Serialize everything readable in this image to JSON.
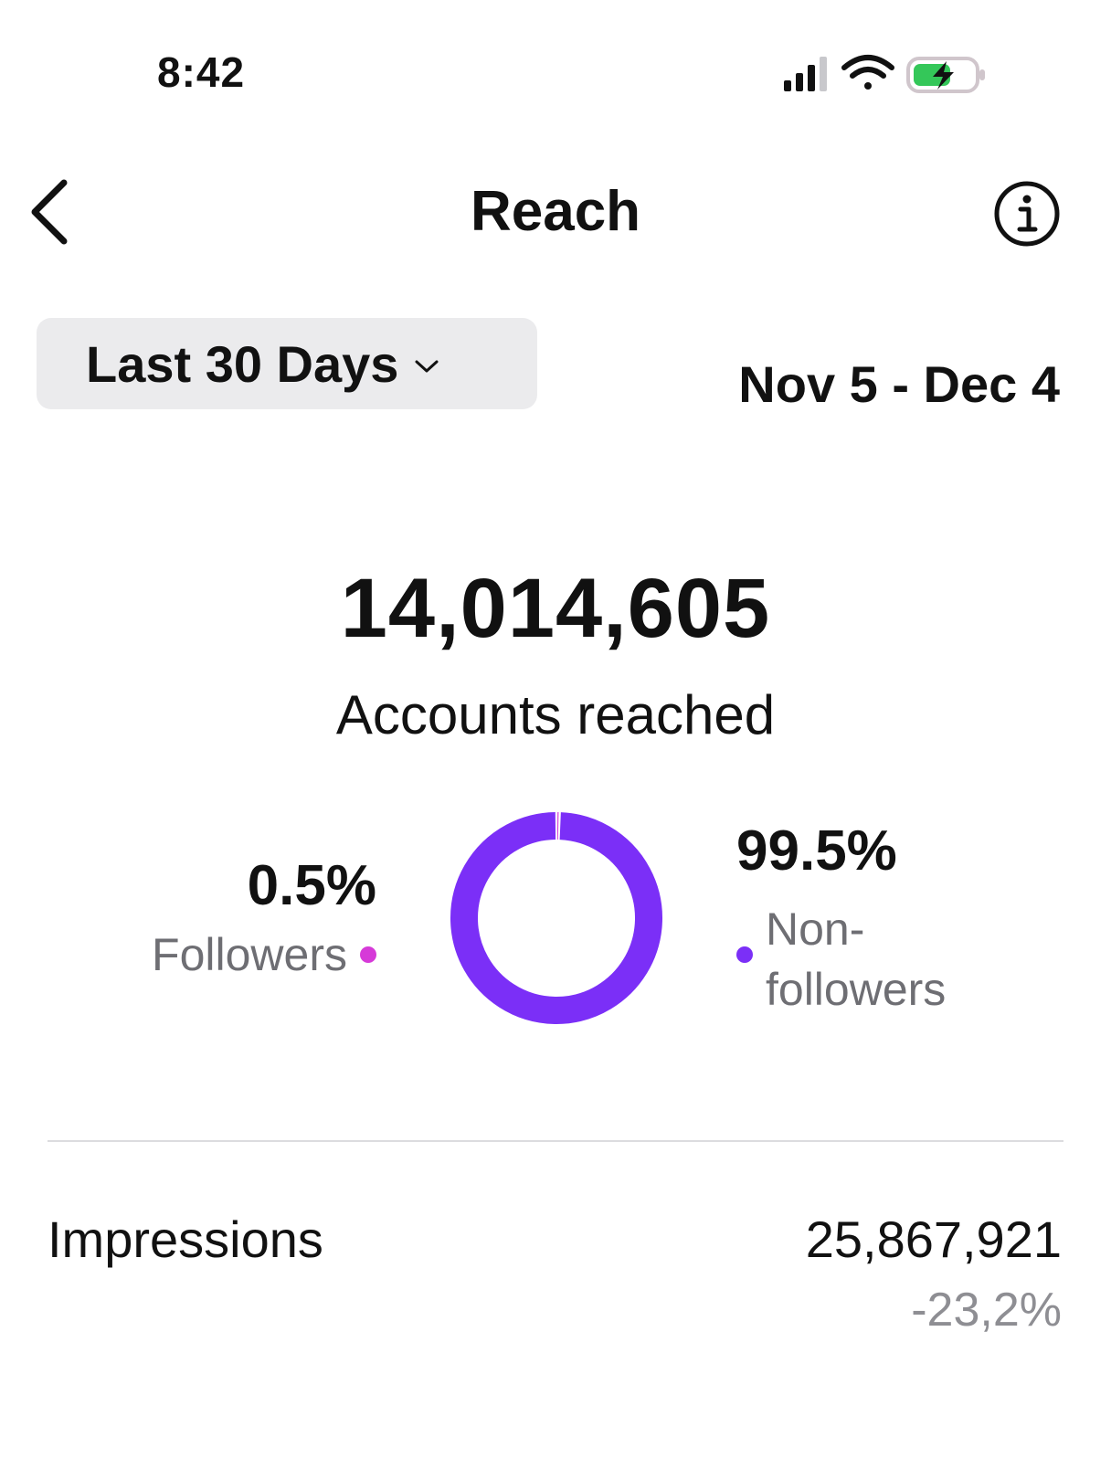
{
  "status_bar": {
    "time": "8:42",
    "icons": [
      "cellular-signal-icon",
      "wifi-icon",
      "battery-charging-icon"
    ]
  },
  "header": {
    "title": "Reach",
    "back_icon": "chevron-left-icon",
    "info_icon": "info-icon"
  },
  "filter": {
    "range_label": "Last 30 Days",
    "chevron_icon": "chevron-down-icon",
    "date_range": "Nov 5 - Dec 4"
  },
  "summary": {
    "total": "14,014,605",
    "total_label": "Accounts reached"
  },
  "chart_data": {
    "type": "pie",
    "donut": true,
    "categories": [
      "Followers",
      "Non-followers"
    ],
    "values": [
      0.5,
      99.5
    ],
    "colors": [
      "#d63ad8",
      "#7b2ff7"
    ],
    "labels": [
      {
        "value": "0.5%",
        "name": "Followers"
      },
      {
        "value": "99.5%",
        "name": "Non-followers"
      }
    ]
  },
  "colors": {
    "followers": "#d63ad8",
    "non_followers": "#7b2ff7",
    "battery_green": "#34c759"
  },
  "impressions": {
    "label": "Impressions",
    "value": "25,867,921",
    "change": "-23,2%"
  }
}
